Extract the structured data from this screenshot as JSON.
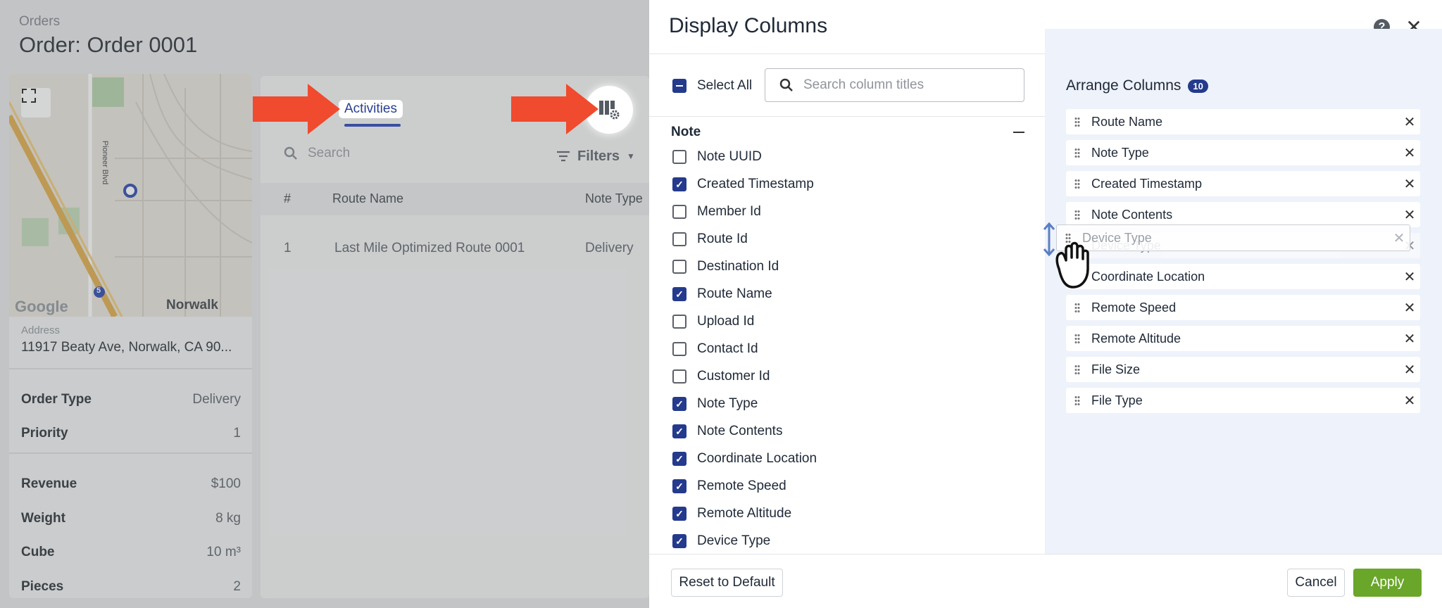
{
  "background": {
    "breadcrumb": "Orders",
    "title": "Order: Order 0001",
    "map": {
      "place_label": "Norwalk",
      "road_label": "Pioneer Blvd",
      "highway_label": "5",
      "provider": "Google"
    },
    "address_label": "Address",
    "address_value": "11917 Beaty Ave, Norwalk, CA 90...",
    "details": [
      {
        "key": "Order Type",
        "value": "Delivery"
      },
      {
        "key": "Priority",
        "value": "1"
      },
      {
        "key": "Revenue",
        "value": "$100"
      },
      {
        "key": "Weight",
        "value": "8 kg"
      },
      {
        "key": "Cube",
        "value": "10 m³"
      },
      {
        "key": "Pieces",
        "value": "2"
      }
    ],
    "tab_label": "Activities",
    "search_placeholder": "Search",
    "filters_label": "Filters",
    "table": {
      "headers": [
        "#",
        "Route Name",
        "Note Type"
      ],
      "row": [
        "1",
        "Last Mile Optimized Route 0001",
        "Delivery"
      ]
    },
    "arrow_color": "#f04a2f"
  },
  "drawer": {
    "title": "Display Columns",
    "select_all_label": "Select All",
    "search_placeholder": "Search column titles",
    "group_label": "Note",
    "options": [
      {
        "label": "Note UUID",
        "checked": false
      },
      {
        "label": "Created Timestamp",
        "checked": true
      },
      {
        "label": "Member Id",
        "checked": false
      },
      {
        "label": "Route Id",
        "checked": false
      },
      {
        "label": "Destination Id",
        "checked": false
      },
      {
        "label": "Route Name",
        "checked": true
      },
      {
        "label": "Upload Id",
        "checked": false
      },
      {
        "label": "Contact Id",
        "checked": false
      },
      {
        "label": "Customer Id",
        "checked": false
      },
      {
        "label": "Note Type",
        "checked": true
      },
      {
        "label": "Note Contents",
        "checked": true
      },
      {
        "label": "Coordinate Location",
        "checked": true
      },
      {
        "label": "Remote Speed",
        "checked": true
      },
      {
        "label": "Remote Altitude",
        "checked": true
      },
      {
        "label": "Device Type",
        "checked": true
      }
    ],
    "arrange_title": "Arrange Columns",
    "arrange_count": "10",
    "arranged": [
      "Route Name",
      "Note Type",
      "Created Timestamp",
      "Note Contents",
      "Device Type",
      "Coordinate Location",
      "Remote Speed",
      "Remote Altitude",
      "File Size",
      "File Type"
    ],
    "dragging_label": "Device Type",
    "reset_label": "Reset to Default",
    "cancel_label": "Cancel",
    "apply_label": "Apply",
    "accent_color": "#243a8c",
    "apply_color": "#6aa629"
  }
}
